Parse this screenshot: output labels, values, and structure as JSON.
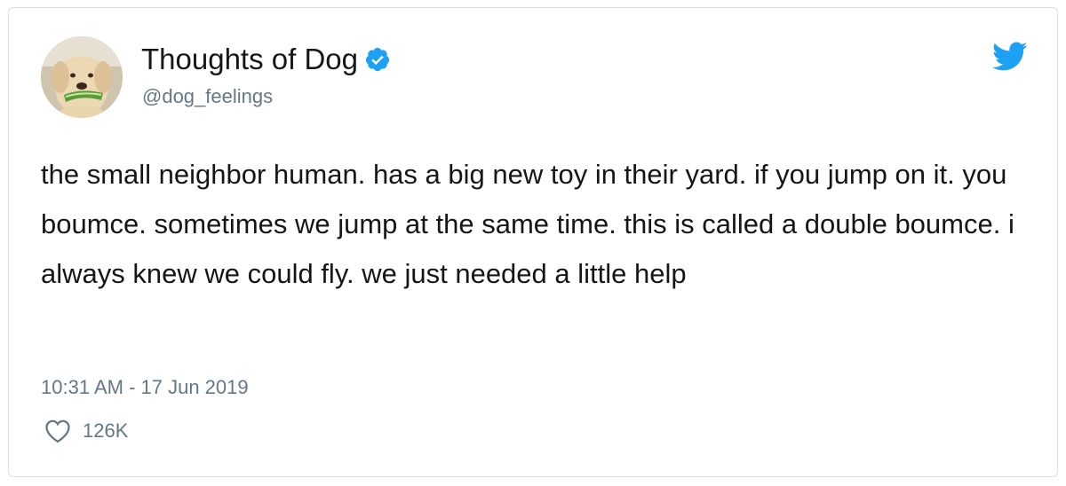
{
  "tweet": {
    "author": {
      "name": "Thoughts of Dog",
      "handle": "@dog_feelings",
      "verified": true,
      "avatar": "dog-with-watermelon-avatar"
    },
    "text": "the small neighbor human. has a big new toy in their yard. if you jump on it. you boumce. sometimes we jump at the same time. this is called a double boumce. i always knew we could fly. we just needed a little help",
    "timestamp": "10:31 AM - 17 Jun 2019",
    "likes": "126K"
  },
  "icons": {
    "verified": "verified-badge-icon",
    "brand": "twitter-bird-icon",
    "like": "heart-icon"
  },
  "colors": {
    "brand_blue": "#1da1f2",
    "text_primary": "#14171a",
    "text_secondary": "#657786",
    "border": "#dcdfe3"
  }
}
